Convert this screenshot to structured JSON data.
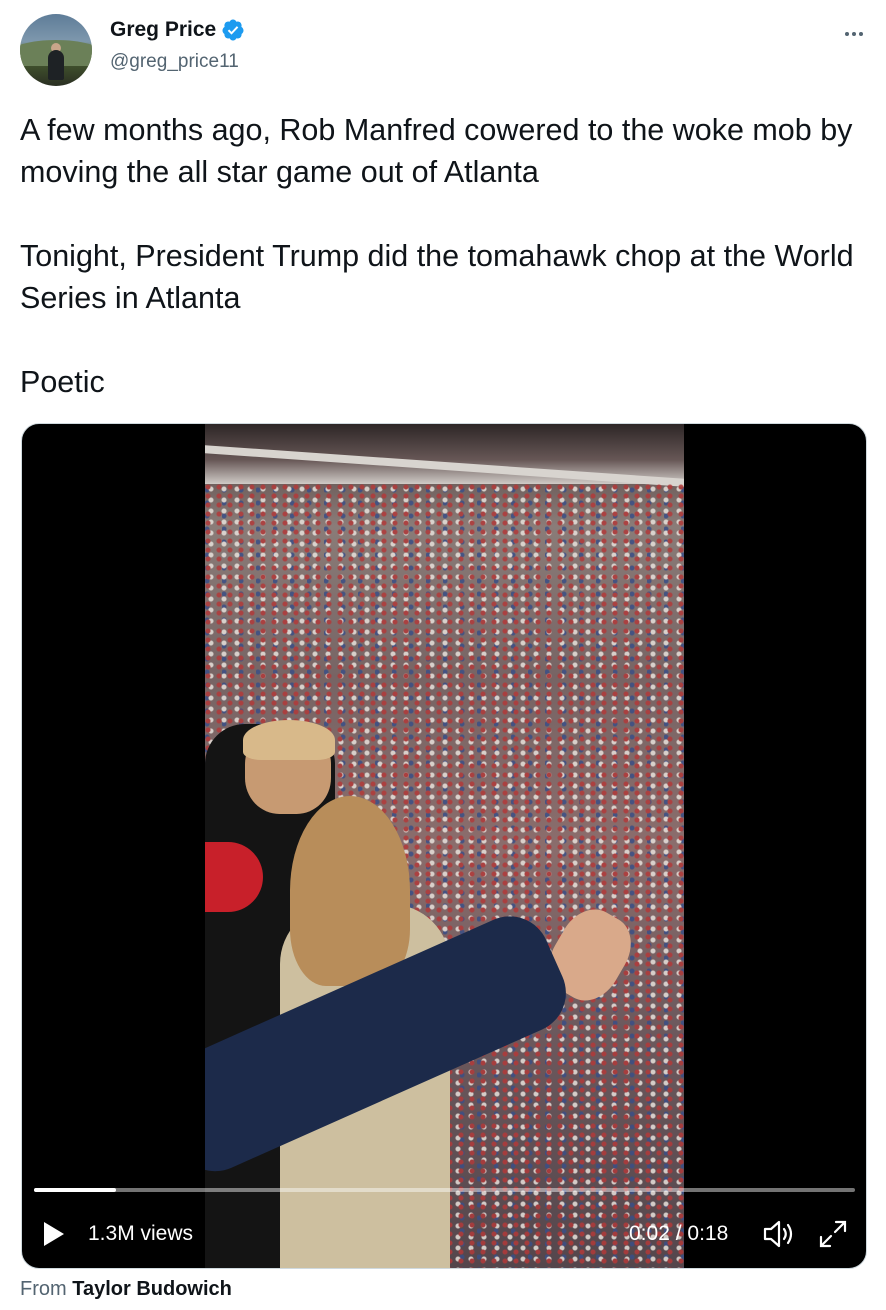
{
  "author": {
    "display_name": "Greg Price",
    "handle": "@greg_price11",
    "verified": true,
    "verified_icon": "verified-badge-icon",
    "accent_color": "#1d9bf0"
  },
  "tweet": {
    "paragraphs": [
      "A few months ago, Rob Manfred cowered to the woke mob by moving the all star game out of Atlanta",
      "Tonight, President Trump did the tomahawk chop at the World Series in Atlanta",
      "Poetic"
    ]
  },
  "video": {
    "views": "1.3M views",
    "current_time": "0:02",
    "separator": "/",
    "duration": "0:18",
    "progress_fraction": 0.1,
    "icons": {
      "play": "play-icon",
      "volume": "volume-icon",
      "fullscreen": "fullscreen-icon",
      "more": "more-horizontal-icon"
    }
  },
  "attribution": {
    "prefix": "From",
    "source": "Taylor Budowich"
  }
}
